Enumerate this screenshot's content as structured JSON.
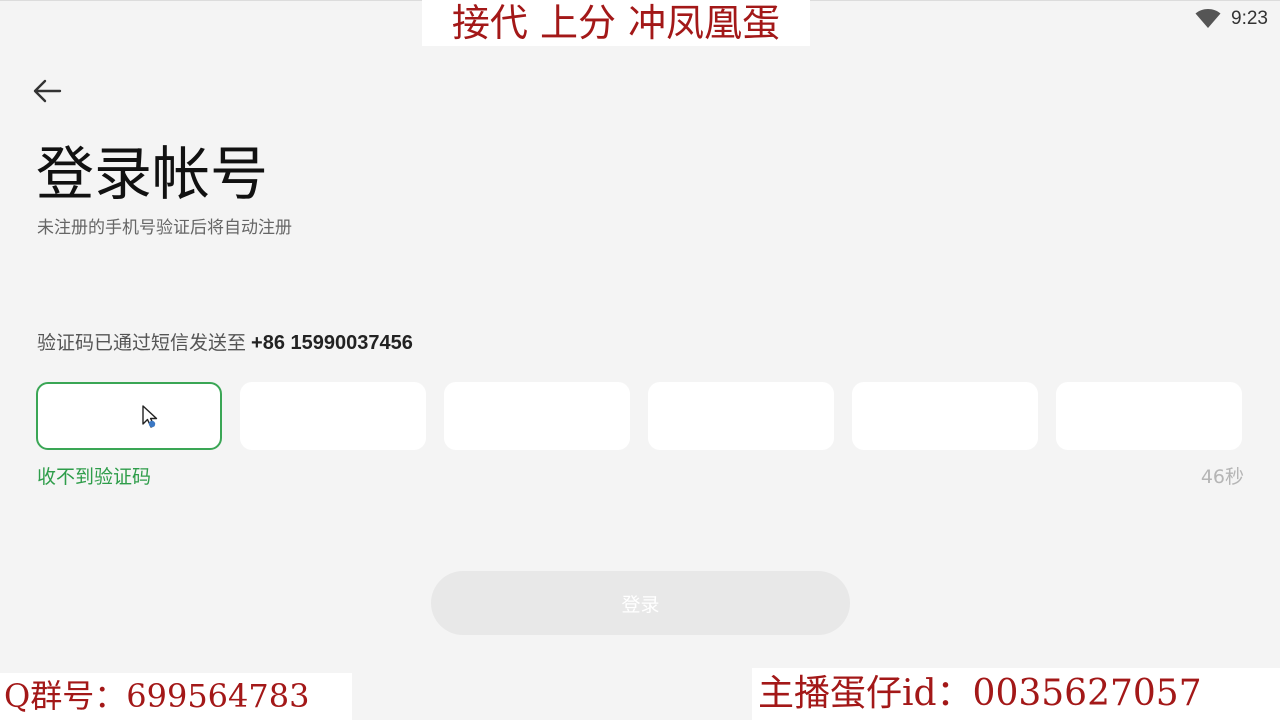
{
  "status_bar": {
    "time": "9:23",
    "icon": "wifi-icon"
  },
  "overlay": {
    "top_banner": "接代 上分 冲凤凰蛋",
    "bottom_left": "Q群号：699564783",
    "bottom_right": "主播蛋仔id：0035627057"
  },
  "header": {
    "back_icon": "arrow-left-icon",
    "title": "登录帐号",
    "subtitle": "未注册的手机号验证后将自动注册"
  },
  "verification": {
    "sent_text": "验证码已通过短信发送至",
    "phone": "+86 15990037456",
    "code_boxes": [
      {
        "value": "",
        "active": true
      },
      {
        "value": "",
        "active": false
      },
      {
        "value": "",
        "active": false
      },
      {
        "value": "",
        "active": false
      },
      {
        "value": "",
        "active": false
      },
      {
        "value": "",
        "active": false
      }
    ],
    "resend_label": "收不到验证码",
    "countdown": "46秒"
  },
  "login_button": {
    "label": "登录",
    "enabled": false
  },
  "colors": {
    "accent": "#3aa655",
    "background": "#f4f4f4",
    "overlay_text": "#a31818",
    "disabled_button": "#e8e8e8"
  }
}
